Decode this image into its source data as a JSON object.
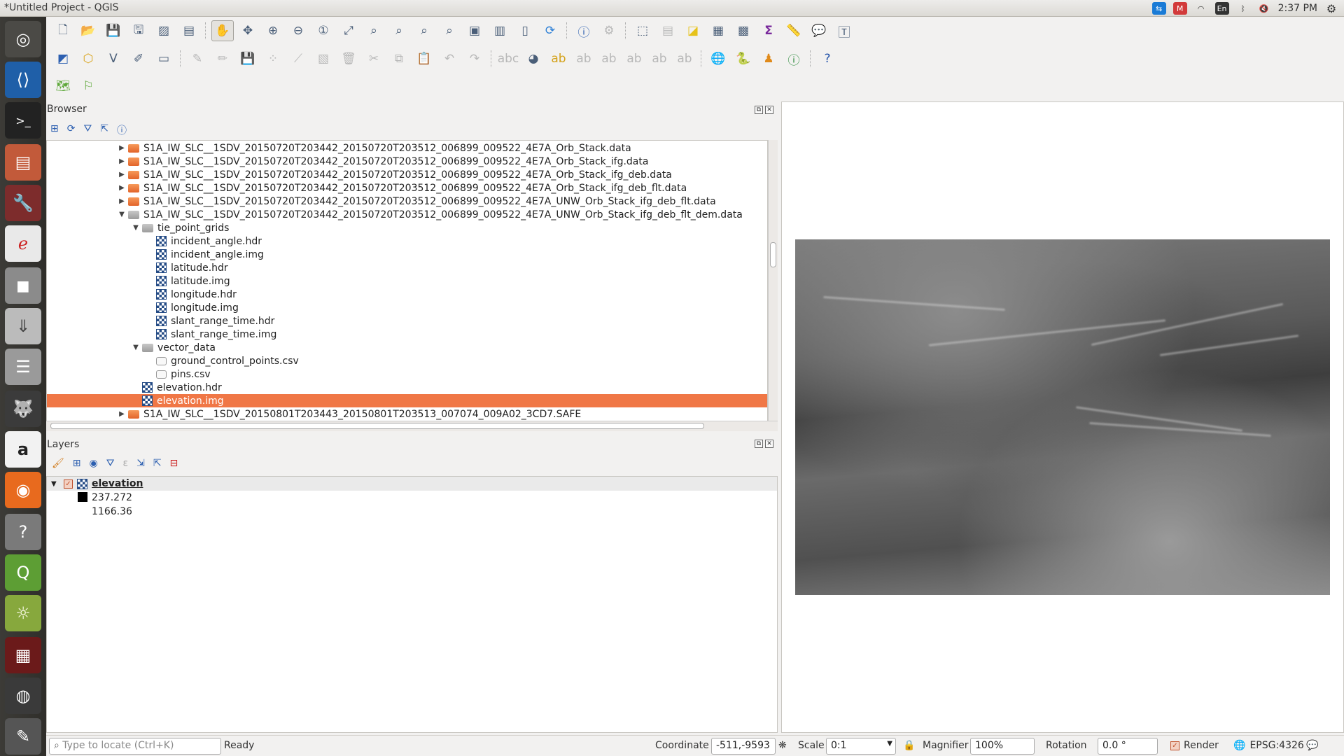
{
  "window": {
    "title": "*Untitled Project - QGIS"
  },
  "system_tray": {
    "language": "En",
    "clock": "2:37 PM"
  },
  "launcher": {
    "items": [
      "ubuntu-dash",
      "vscode",
      "terminal",
      "files",
      "settings",
      "text-editor",
      "disks",
      "install",
      "database",
      "gimp",
      "amazon",
      "firefox",
      "help",
      "qgis",
      "snap",
      "presentation",
      "chrome",
      "editor"
    ]
  },
  "browser": {
    "title": "Browser",
    "items": [
      {
        "label": "S1A_IW_SLC__1SDV_20150720T203442_20150720T203512_006899_009522_4E7A_Orb_Stack.data",
        "indent": 0,
        "expanded": false,
        "kind": "folder"
      },
      {
        "label": "S1A_IW_SLC__1SDV_20150720T203442_20150720T203512_006899_009522_4E7A_Orb_Stack_ifg.data",
        "indent": 0,
        "expanded": false,
        "kind": "folder"
      },
      {
        "label": "S1A_IW_SLC__1SDV_20150720T203442_20150720T203512_006899_009522_4E7A_Orb_Stack_ifg_deb.data",
        "indent": 0,
        "expanded": false,
        "kind": "folder"
      },
      {
        "label": "S1A_IW_SLC__1SDV_20150720T203442_20150720T203512_006899_009522_4E7A_Orb_Stack_ifg_deb_flt.data",
        "indent": 0,
        "expanded": false,
        "kind": "folder"
      },
      {
        "label": "S1A_IW_SLC__1SDV_20150720T203442_20150720T203512_006899_009522_4E7A_UNW_Orb_Stack_ifg_deb_flt.data",
        "indent": 0,
        "expanded": false,
        "kind": "folder"
      },
      {
        "label": "S1A_IW_SLC__1SDV_20150720T203442_20150720T203512_006899_009522_4E7A_UNW_Orb_Stack_ifg_deb_flt_dem.data",
        "indent": 0,
        "expanded": true,
        "kind": "folder-gray"
      },
      {
        "label": "tie_point_grids",
        "indent": 1,
        "expanded": true,
        "kind": "folder-gray"
      },
      {
        "label": "incident_angle.hdr",
        "indent": 2,
        "kind": "raster"
      },
      {
        "label": "incident_angle.img",
        "indent": 2,
        "kind": "raster"
      },
      {
        "label": "latitude.hdr",
        "indent": 2,
        "kind": "raster"
      },
      {
        "label": "latitude.img",
        "indent": 2,
        "kind": "raster"
      },
      {
        "label": "longitude.hdr",
        "indent": 2,
        "kind": "raster"
      },
      {
        "label": "longitude.img",
        "indent": 2,
        "kind": "raster"
      },
      {
        "label": "slant_range_time.hdr",
        "indent": 2,
        "kind": "raster"
      },
      {
        "label": "slant_range_time.img",
        "indent": 2,
        "kind": "raster"
      },
      {
        "label": "vector_data",
        "indent": 1,
        "expanded": true,
        "kind": "folder-gray"
      },
      {
        "label": "ground_control_points.csv",
        "indent": 2,
        "kind": "vector"
      },
      {
        "label": "pins.csv",
        "indent": 2,
        "kind": "vector"
      },
      {
        "label": "elevation.hdr",
        "indent": 1,
        "kind": "raster"
      },
      {
        "label": "elevation.img",
        "indent": 1,
        "kind": "raster",
        "selected": true
      },
      {
        "label": "S1A_IW_SLC__1SDV_20150801T203443_20150801T203513_007074_009A02_3CD7.SAFE",
        "indent": 0,
        "expanded": false,
        "kind": "folder"
      }
    ]
  },
  "layers": {
    "title": "Layers",
    "layer_name": "elevation",
    "legend_min": "237.272",
    "legend_max": "1166.36"
  },
  "status": {
    "locate_placeholder": "Type to locate (Ctrl+K)",
    "state": "Ready",
    "coordinate_label": "Coordinate",
    "coordinate_value": "-511,-9593",
    "scale_label": "Scale",
    "scale_value": "0:1",
    "magnifier_label": "Magnifier",
    "magnifier_value": "100%",
    "rotation_label": "Rotation",
    "rotation_value": "0.0 °",
    "render_label": "Render",
    "crs": "EPSG:4326"
  }
}
